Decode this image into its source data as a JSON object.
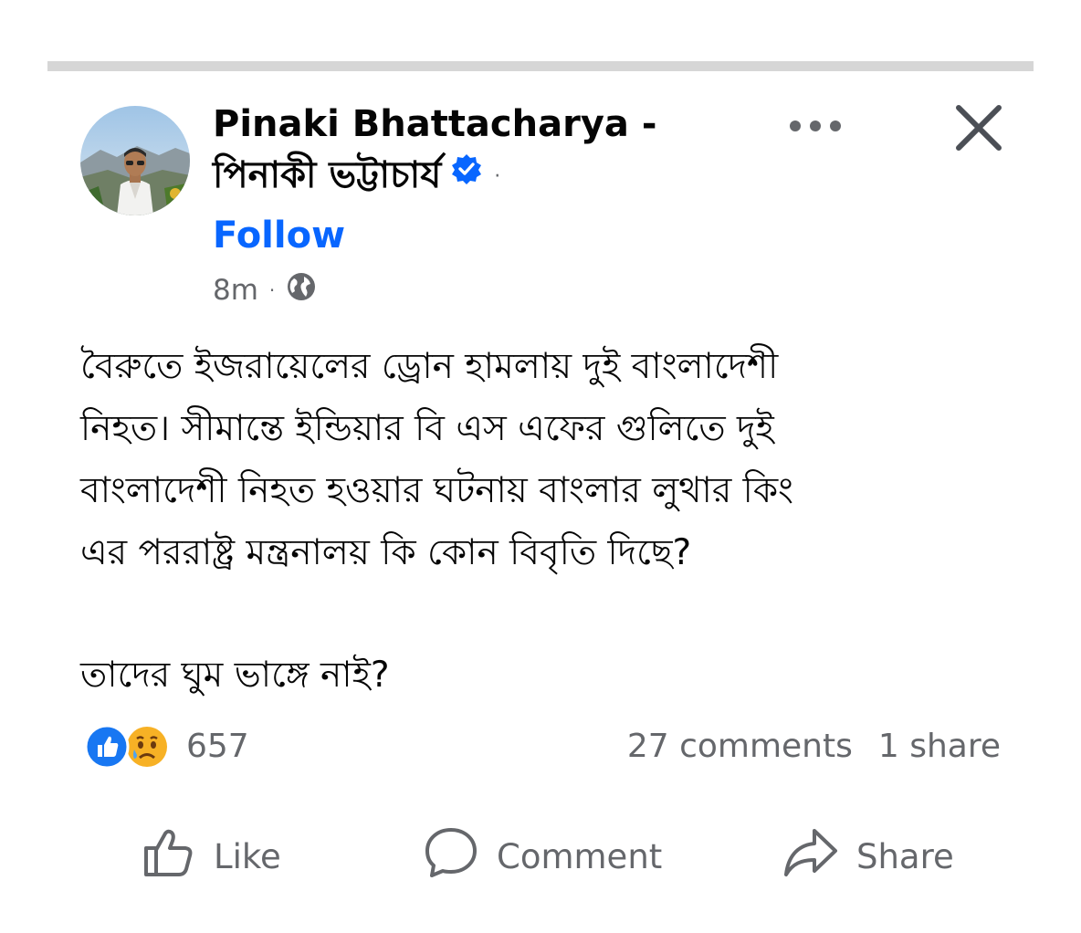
{
  "post": {
    "author_line1": "Pinaki Bhattacharya -",
    "author_line2": "পিনাকী ভট্টাচার্য",
    "author_dot": "·",
    "follow_label": "Follow",
    "timestamp": "8m",
    "meta_sep": "·",
    "body_lines": [
      "বৈরুতে ইজরায়েলের ড্রোন হামলায় দুই বাংলাদেশী",
      "নিহত। সীমান্তে ইন্ডিয়ার বি এস এফের গুলিতে দুই",
      "বাংলাদেশী নিহত হওয়ার ঘটনায় বাংলার লুথার কিং",
      "এর পররাষ্ট্র মন্ত্রনালয় কি কোন বিবৃতি দিছে?"
    ],
    "body_last": "তাদের ঘুম ভাঙ্গে নাই?",
    "reaction_count": "657",
    "comments": "27 comments",
    "shares": "1 share",
    "reaction_icons": [
      "like-reaction",
      "sad-reaction"
    ]
  },
  "actions": {
    "like": "Like",
    "comment": "Comment",
    "share": "Share"
  },
  "icons": {
    "avatar": "profile-photo",
    "verified": "verified-badge-icon",
    "audience": "globe-icon",
    "more": "more-options-icon",
    "close": "close-icon",
    "like": "thumbs-up-icon",
    "comment": "comment-bubble-icon",
    "share": "share-arrow-icon"
  },
  "colors": {
    "link_blue": "#0866ff",
    "secondary_text": "#65676b",
    "divider": "#d6d6d6",
    "like_reaction": "#1877f2",
    "sad_reaction": "#f7b125"
  }
}
